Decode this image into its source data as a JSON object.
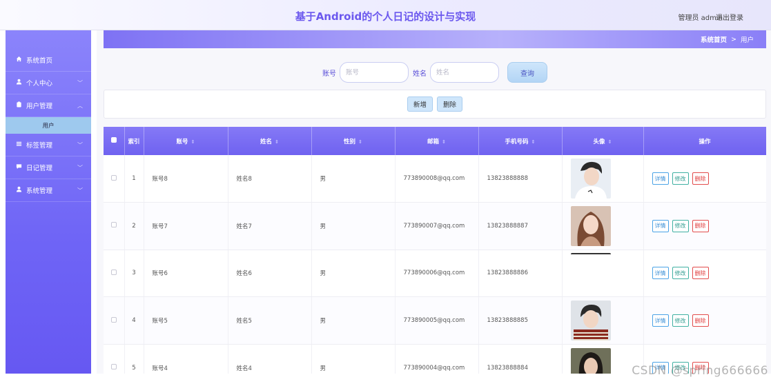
{
  "header": {
    "title": "基于Android的个人日记的设计与实现",
    "user": "管理员 admin",
    "logout": "退出登录"
  },
  "sidebar": {
    "items": [
      {
        "label": "系统首页",
        "icon": "home-icon",
        "chevron": ""
      },
      {
        "label": "个人中心",
        "icon": "user-icon",
        "chevron": "﹀"
      },
      {
        "label": "用户管理",
        "icon": "clipboard-icon",
        "chevron": "︿"
      },
      {
        "label": "标签管理",
        "icon": "list-icon",
        "chevron": "﹀"
      },
      {
        "label": "日记管理",
        "icon": "chat-icon",
        "chevron": "﹀"
      },
      {
        "label": "系统管理",
        "icon": "user-icon",
        "chevron": "﹀"
      }
    ],
    "sub_item": "用户"
  },
  "breadcrumb": {
    "home": "系统首页",
    "sep": ">",
    "current": "用户"
  },
  "search": {
    "account_label": "账号",
    "account_placeholder": "账号",
    "name_label": "姓名",
    "name_placeholder": "姓名",
    "button": "查询"
  },
  "actions": {
    "add": "新增",
    "delete": "删除"
  },
  "table": {
    "columns": [
      "索引",
      "账号",
      "姓名",
      "性别",
      "邮箱",
      "手机号码",
      "头像",
      "操作"
    ],
    "rows": [
      {
        "idx": "1",
        "account": "账号8",
        "name": "姓名8",
        "gender": "男",
        "email": "773890008@qq.com",
        "phone": "13823888888",
        "avatar": "boy-white"
      },
      {
        "idx": "2",
        "account": "账号7",
        "name": "姓名7",
        "gender": "男",
        "email": "773890007@qq.com",
        "phone": "13823888887",
        "avatar": "girl-longhair"
      },
      {
        "idx": "3",
        "account": "账号6",
        "name": "姓名6",
        "gender": "男",
        "email": "773890006@qq.com",
        "phone": "13823888886",
        "avatar": "none"
      },
      {
        "idx": "4",
        "account": "账号5",
        "name": "姓名5",
        "gender": "男",
        "email": "773890005@qq.com",
        "phone": "13823888885",
        "avatar": "boy-stripes"
      },
      {
        "idx": "5",
        "account": "账号4",
        "name": "姓名4",
        "gender": "男",
        "email": "773890004@qq.com",
        "phone": "13823888884",
        "avatar": "girl-dark"
      }
    ],
    "ops": {
      "detail": "详情",
      "edit": "修改",
      "delete": "删除"
    }
  },
  "watermark": "CSDN @spring666666"
}
